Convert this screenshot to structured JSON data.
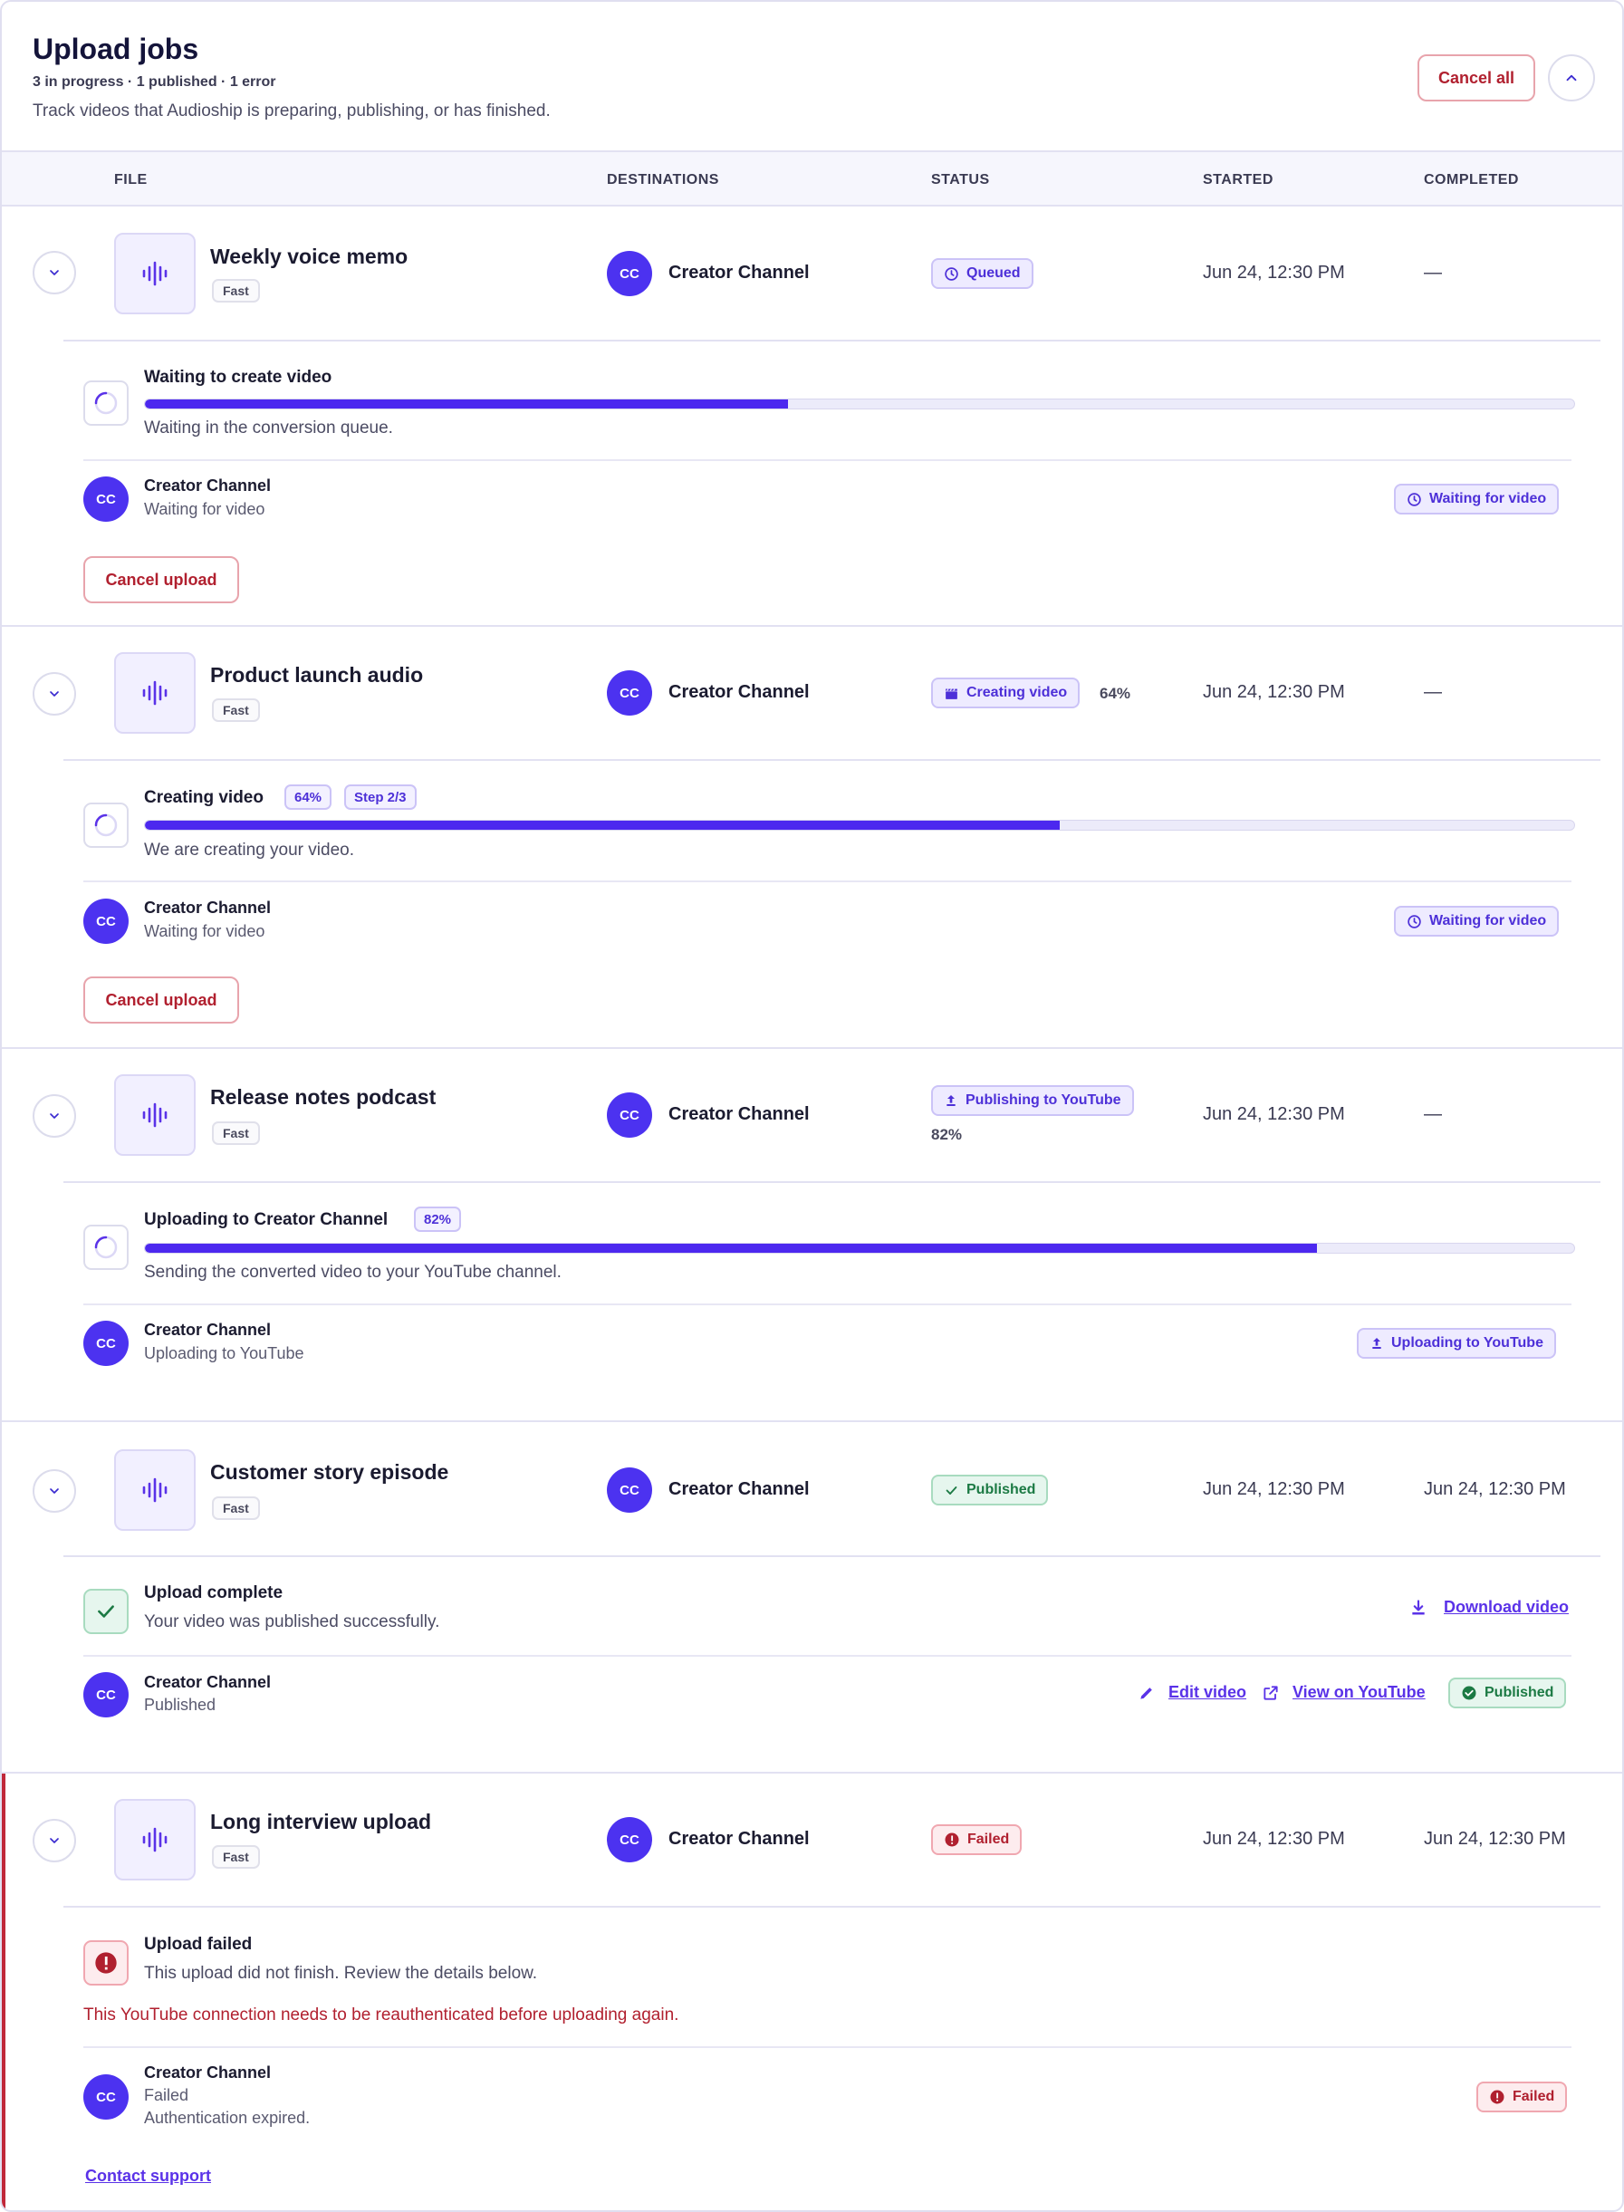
{
  "header": {
    "title": "Upload jobs",
    "summary": "3 in progress · 1 published · 1 error",
    "subtitle": "Track videos that Audioship is preparing, publishing, or has finished.",
    "cancel_all_label": "Cancel all"
  },
  "columns": {
    "file": "FILE",
    "destinations": "DESTINATIONS",
    "status": "STATUS",
    "started": "STARTED",
    "completed": "COMPLETED"
  },
  "colors": {
    "accent": "#4c28ef",
    "success": "#1c7a44",
    "error": "#b0202f"
  },
  "jobs": [
    {
      "file_name": "Weekly voice memo",
      "speed": "Fast",
      "avatar": "CC",
      "destination": "Creator Channel",
      "status_label": "Queued",
      "status_icon": "clock-icon",
      "started": "Jun 24, 12:30 PM",
      "completed": "—",
      "step_title": "Waiting to create video",
      "step_desc": "Waiting in the conversion queue.",
      "progress": 0.45,
      "dest_title": "Creator Channel",
      "dest_status": "Waiting for video",
      "dest_pill": "Waiting for video",
      "cancel_label": "Cancel upload"
    },
    {
      "file_name": "Product launch audio",
      "speed": "Fast",
      "avatar": "CC",
      "destination": "Creator Channel",
      "status_label": "Creating video",
      "status_icon": "clapperboard-icon",
      "status_pct": "64%",
      "started": "Jun 24, 12:30 PM",
      "completed": "—",
      "step_title": "Creating video",
      "step_tag_pct": "64%",
      "step_tag_step": "Step 2/3",
      "step_desc": "We are creating your video.",
      "progress": 0.64,
      "dest_title": "Creator Channel",
      "dest_status": "Waiting for video",
      "dest_pill": "Waiting for video",
      "cancel_label": "Cancel upload"
    },
    {
      "file_name": "Release notes podcast",
      "speed": "Fast",
      "avatar": "CC",
      "destination": "Creator Channel",
      "status_label": "Publishing to YouTube",
      "status_icon": "upload-icon",
      "status_pct": "82%",
      "started": "Jun 24, 12:30 PM",
      "completed": "—",
      "step_title": "Uploading to Creator Channel",
      "step_tag_pct": "82%",
      "step_desc": "Sending the converted video to your YouTube channel.",
      "progress": 0.82,
      "dest_title": "Creator Channel",
      "dest_status": "Uploading to YouTube",
      "dest_pill": "Uploading to YouTube"
    },
    {
      "file_name": "Customer story episode",
      "speed": "Fast",
      "avatar": "CC",
      "destination": "Creator Channel",
      "status_label": "Published",
      "status_icon": "check-icon",
      "started": "Jun 24, 12:30 PM",
      "completed": "Jun 24, 12:30 PM",
      "step_title": "Upload complete",
      "step_desc": "Your video was published successfully.",
      "download_label": "Download video",
      "dest_title": "Creator Channel",
      "dest_status": "Published",
      "edit_label": "Edit video",
      "view_label": "View on YouTube",
      "dest_pill": "Published"
    },
    {
      "file_name": "Long interview upload",
      "speed": "Fast",
      "avatar": "CC",
      "destination": "Creator Channel",
      "status_label": "Failed",
      "status_icon": "alert-icon",
      "started": "Jun 24, 12:30 PM",
      "completed": "Jun 24, 12:30 PM",
      "step_title": "Upload failed",
      "step_desc": "This upload did not finish. Review the details below.",
      "error_msg": "This YouTube connection needs to be reauthenticated before uploading again.",
      "dest_title": "Creator Channel",
      "dest_status": "Failed",
      "dest_detail": "Authentication expired.",
      "dest_pill": "Failed",
      "support_label": "Contact support"
    }
  ]
}
